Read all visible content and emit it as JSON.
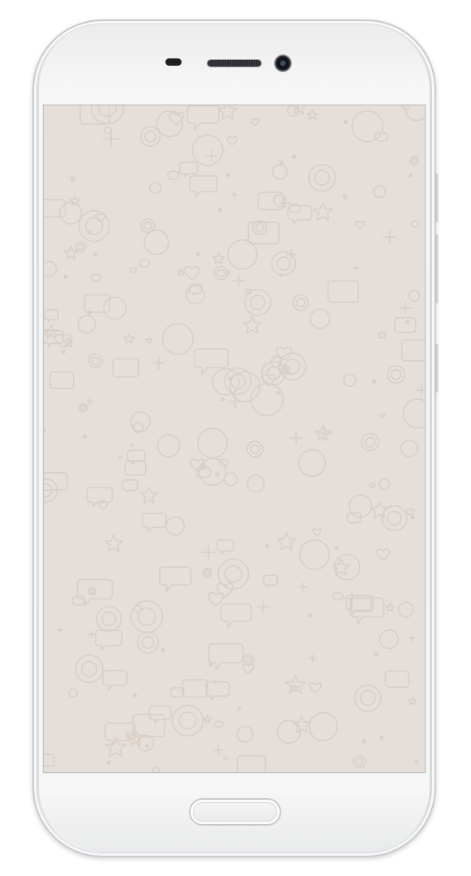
{
  "device": {
    "frame_color": "#f3f4f5",
    "screen_background": "#e6ded8",
    "doodle_color": "#d8cfc8"
  },
  "icons": [
    "earpiece-icon",
    "speaker-grille-icon",
    "front-camera-icon",
    "home-button-icon",
    "chat-wallpaper-doodles"
  ]
}
